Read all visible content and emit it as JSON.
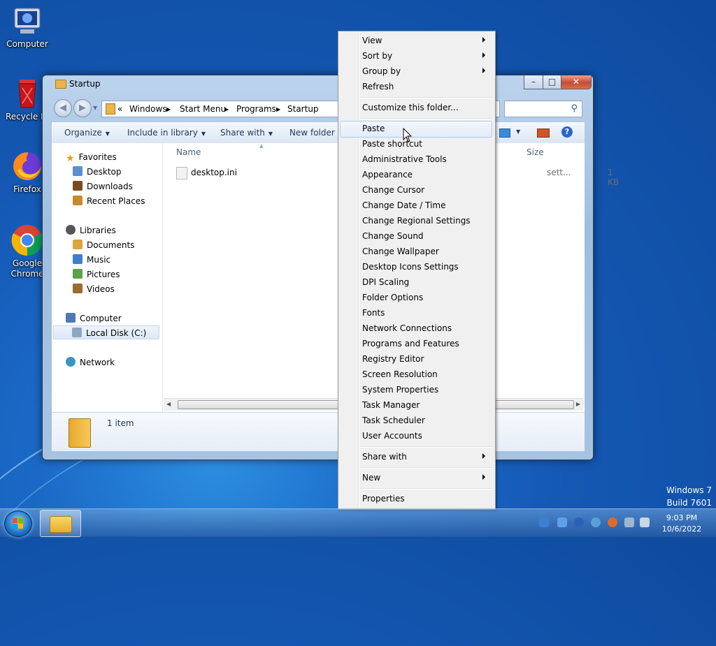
{
  "desktop": {
    "icons": [
      {
        "label": "Computer",
        "icon": "computer-icon"
      },
      {
        "label": "Recycle Bin",
        "icon": "recycle-bin-icon"
      },
      {
        "label": "Firefox",
        "icon": "firefox-icon"
      },
      {
        "label": "Google Chrome",
        "icon": "chrome-icon"
      }
    ],
    "watermark_line1": "Windows 7",
    "watermark_line2": "Build 7601"
  },
  "window": {
    "title": "Startup",
    "breadcrumb": [
      "«",
      "Windows",
      "Start Menu",
      "Programs",
      "Startup"
    ],
    "toolbar": {
      "organize": "Organize",
      "include": "Include in library",
      "share": "Share with",
      "new_folder": "New folder"
    },
    "nav": {
      "favorites": "Favorites",
      "desktop": "Desktop",
      "downloads": "Downloads",
      "recent": "Recent Places",
      "libraries": "Libraries",
      "documents": "Documents",
      "music": "Music",
      "pictures": "Pictures",
      "videos": "Videos",
      "computer": "Computer",
      "local_disk": "Local Disk (C:)",
      "network": "Network"
    },
    "columns": {
      "name": "Name",
      "size": "Size"
    },
    "files": [
      {
        "name": "desktop.ini",
        "type_partial": "sett...",
        "size": "1 KB"
      }
    ],
    "status": "1 item"
  },
  "context_menu": {
    "view": "View",
    "sort_by": "Sort by",
    "group_by": "Group by",
    "refresh": "Refresh",
    "customize": "Customize this folder...",
    "paste": "Paste",
    "paste_shortcut": "Paste shortcut",
    "admin_tools": "Administrative Tools",
    "appearance": "Appearance",
    "change_cursor": "Change Cursor",
    "change_date_time": "Change Date / Time",
    "change_regional": "Change Regional Settings",
    "change_sound": "Change Sound",
    "change_wallpaper": "Change Wallpaper",
    "desktop_icons": "Desktop Icons Settings",
    "dpi_scaling": "DPI Scaling",
    "folder_options": "Folder Options",
    "fonts": "Fonts",
    "network_connections": "Network Connections",
    "programs_features": "Programs and Features",
    "registry_editor": "Registry Editor",
    "screen_resolution": "Screen Resolution",
    "system_properties": "System Properties",
    "task_manager": "Task Manager",
    "task_scheduler": "Task Scheduler",
    "user_accounts": "User Accounts",
    "share_with": "Share with",
    "new": "New",
    "properties": "Properties"
  },
  "taskbar": {
    "time": "9:03 PM",
    "date": "10/6/2022"
  },
  "colors": {
    "menu_bg": "#f0f0f0",
    "highlight_border": "#aecdf2",
    "desktop_blue": "#1458b3"
  }
}
